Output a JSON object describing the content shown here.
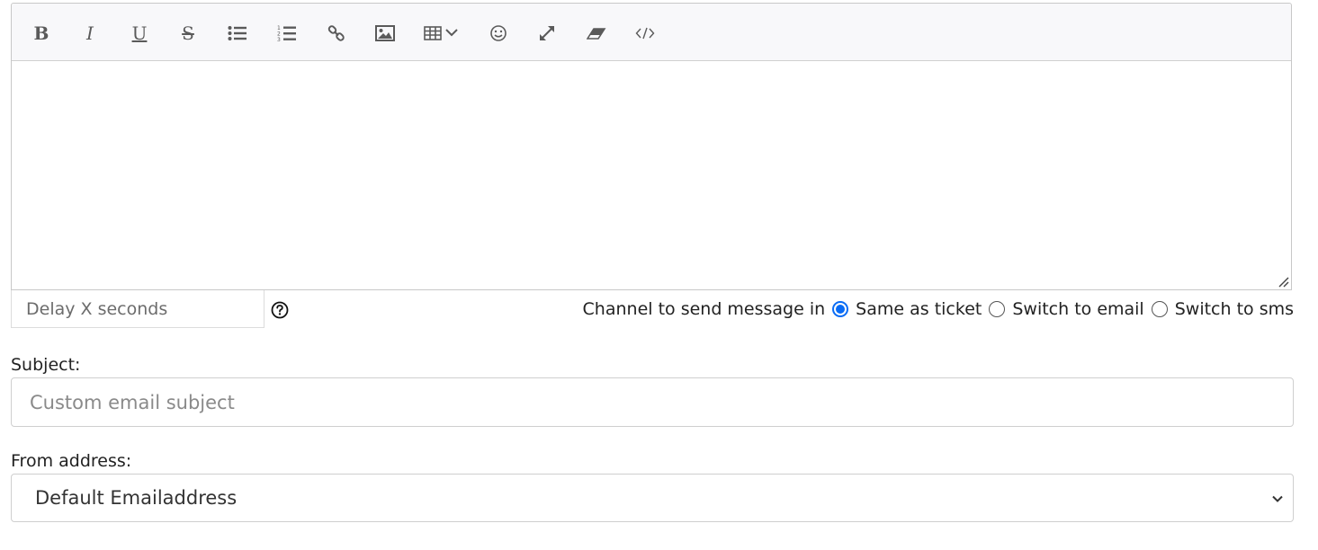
{
  "editor": {
    "toolbar": {
      "bold": "B",
      "italic": "I",
      "underline": "U",
      "strikethrough": "S"
    },
    "content": ""
  },
  "delay": {
    "placeholder": "Delay X seconds",
    "value": ""
  },
  "channel": {
    "label": "Channel to send message in",
    "options": [
      {
        "label": "Same as ticket",
        "checked": true
      },
      {
        "label": "Switch to email",
        "checked": false
      },
      {
        "label": "Switch to sms",
        "checked": false
      }
    ]
  },
  "subject": {
    "label": "Subject:",
    "placeholder": "Custom email subject",
    "value": ""
  },
  "from_address": {
    "label": "From address:",
    "selected": "Default Emailaddress"
  },
  "colors": {
    "accent": "#0a6cf5",
    "toolbar_bg": "#f8f8fa",
    "icon": "#5a5a5a"
  }
}
